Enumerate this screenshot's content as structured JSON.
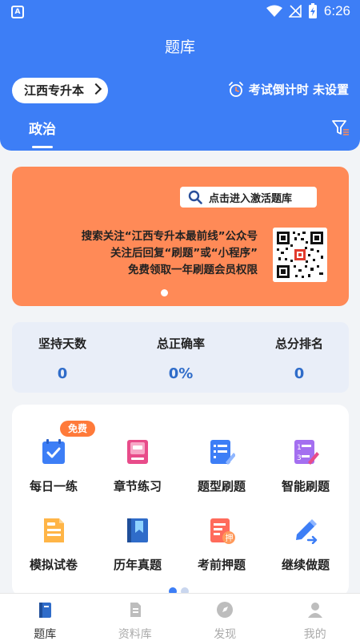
{
  "status_bar": {
    "time": "6:26",
    "app_icon_letter": "A"
  },
  "header": {
    "title": "题库",
    "region": "江西专升本",
    "countdown": "考试倒计时 未设置",
    "active_tab": "政治"
  },
  "banner": {
    "button_label": "点击进入激活题库",
    "line1": "搜索关注“江西专升本最前线”公众号",
    "line2": "关注后回复“刷题”或“小程序”",
    "line3": "免费领取一年刷题会员权限"
  },
  "stats": [
    {
      "label": "坚持天数",
      "value": "0"
    },
    {
      "label": "总正确率",
      "value": "0%"
    },
    {
      "label": "总分排名",
      "value": "0"
    }
  ],
  "features": [
    {
      "label": "每日一练",
      "icon": "daily-check-icon"
    },
    {
      "label": "章节练习",
      "icon": "chapter-book-icon"
    },
    {
      "label": "题型刷题",
      "icon": "list-edit-icon"
    },
    {
      "label": "智能刷题",
      "icon": "smart-numbered-list-icon"
    },
    {
      "label": "模拟试卷",
      "icon": "mock-paper-icon"
    },
    {
      "label": "历年真题",
      "icon": "past-exam-book-icon"
    },
    {
      "label": "考前押题",
      "icon": "prediction-doc-icon"
    },
    {
      "label": "继续做题",
      "icon": "continue-pen-icon"
    }
  ],
  "free_badge": "免费",
  "bottom_nav": [
    {
      "label": "题库",
      "icon": "question-bank-icon",
      "active": true
    },
    {
      "label": "资料库",
      "icon": "materials-icon",
      "active": false
    },
    {
      "label": "发现",
      "icon": "discover-icon",
      "active": false
    },
    {
      "label": "我的",
      "icon": "profile-icon",
      "active": false
    }
  ],
  "colors": {
    "primary": "#3d7ef6",
    "banner": "#ff8a57",
    "badge": "#ff7a3a",
    "stat_value": "#2f6cc9"
  }
}
